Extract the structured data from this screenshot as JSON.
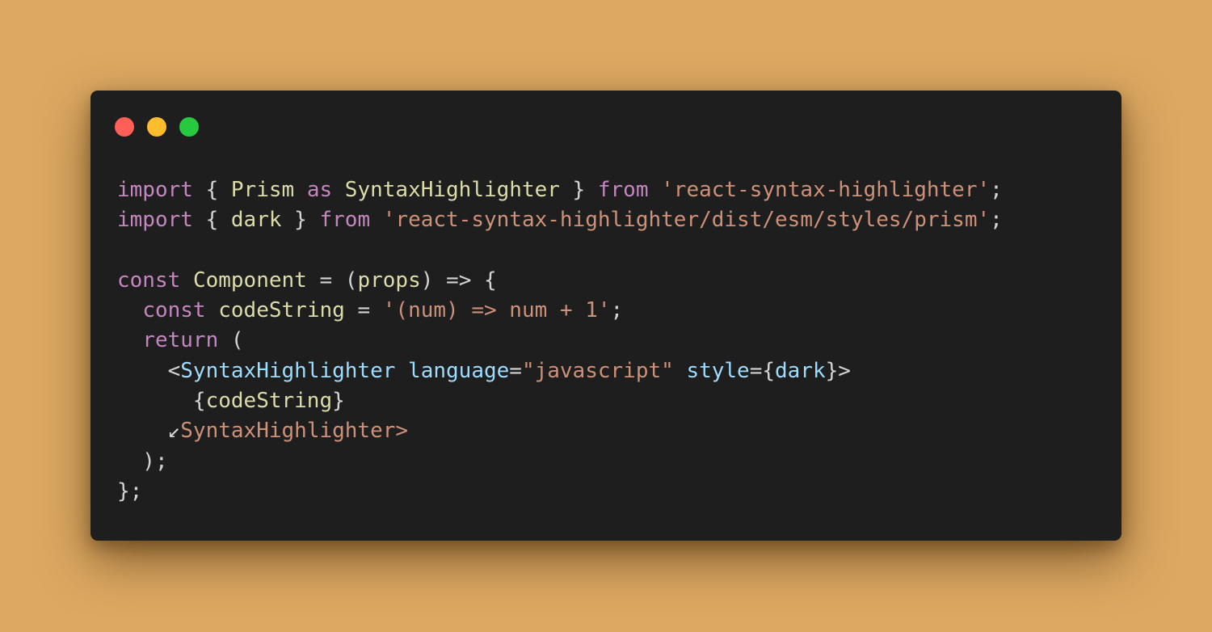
{
  "window": {
    "controls": [
      {
        "name": "close-control",
        "color": "#ff5f56"
      },
      {
        "name": "minimize-control",
        "color": "#ffbd2e"
      },
      {
        "name": "maximize-control",
        "color": "#27c93f"
      }
    ]
  },
  "colors": {
    "keyword": "#c586c0",
    "plain": "#d4d4d4",
    "identifier": "#dcdcaa",
    "string": "#ce9178",
    "tag": "#9cdcfe"
  },
  "code": {
    "lines": [
      [
        {
          "t": "import",
          "c": "keyword"
        },
        {
          "t": " { ",
          "c": "plain"
        },
        {
          "t": "Prism",
          "c": "identifier"
        },
        {
          "t": " ",
          "c": "plain"
        },
        {
          "t": "as",
          "c": "keyword"
        },
        {
          "t": " ",
          "c": "plain"
        },
        {
          "t": "SyntaxHighlighter",
          "c": "identifier"
        },
        {
          "t": " } ",
          "c": "plain"
        },
        {
          "t": "from",
          "c": "keyword"
        },
        {
          "t": " ",
          "c": "plain"
        },
        {
          "t": "'react-syntax-highlighter'",
          "c": "string"
        },
        {
          "t": ";",
          "c": "plain"
        }
      ],
      [
        {
          "t": "import",
          "c": "keyword"
        },
        {
          "t": " { ",
          "c": "plain"
        },
        {
          "t": "dark",
          "c": "identifier"
        },
        {
          "t": " } ",
          "c": "plain"
        },
        {
          "t": "from",
          "c": "keyword"
        },
        {
          "t": " ",
          "c": "plain"
        },
        {
          "t": "'react-syntax-highlighter/dist/esm/styles/prism'",
          "c": "string"
        },
        {
          "t": ";",
          "c": "plain"
        }
      ],
      [],
      [
        {
          "t": "const",
          "c": "keyword"
        },
        {
          "t": " ",
          "c": "plain"
        },
        {
          "t": "Component",
          "c": "identifier"
        },
        {
          "t": " = (",
          "c": "plain"
        },
        {
          "t": "props",
          "c": "identifier"
        },
        {
          "t": ") => {",
          "c": "plain"
        }
      ],
      [
        {
          "t": "  ",
          "c": "plain"
        },
        {
          "t": "const",
          "c": "keyword"
        },
        {
          "t": " ",
          "c": "plain"
        },
        {
          "t": "codeString",
          "c": "identifier"
        },
        {
          "t": " = ",
          "c": "plain"
        },
        {
          "t": "'(num) => num + 1'",
          "c": "string"
        },
        {
          "t": ";",
          "c": "plain"
        }
      ],
      [
        {
          "t": "  ",
          "c": "plain"
        },
        {
          "t": "return",
          "c": "keyword"
        },
        {
          "t": " (",
          "c": "plain"
        }
      ],
      [
        {
          "t": "    <",
          "c": "plain"
        },
        {
          "t": "SyntaxHighlighter",
          "c": "tag"
        },
        {
          "t": " ",
          "c": "plain"
        },
        {
          "t": "language",
          "c": "tag"
        },
        {
          "t": "=",
          "c": "plain"
        },
        {
          "t": "\"javascript\"",
          "c": "string"
        },
        {
          "t": " ",
          "c": "plain"
        },
        {
          "t": "style",
          "c": "tag"
        },
        {
          "t": "={",
          "c": "plain"
        },
        {
          "t": "dark",
          "c": "tag"
        },
        {
          "t": "}>",
          "c": "plain"
        }
      ],
      [
        {
          "t": "      {",
          "c": "plain"
        },
        {
          "t": "codeString",
          "c": "identifier"
        },
        {
          "t": "}",
          "c": "plain"
        }
      ],
      [
        {
          "t": "    ↙",
          "c": "plain"
        },
        {
          "t": "SyntaxHighlighter>",
          "c": "string"
        }
      ],
      [
        {
          "t": "  );",
          "c": "plain"
        }
      ],
      [
        {
          "t": "};",
          "c": "plain"
        }
      ]
    ]
  }
}
